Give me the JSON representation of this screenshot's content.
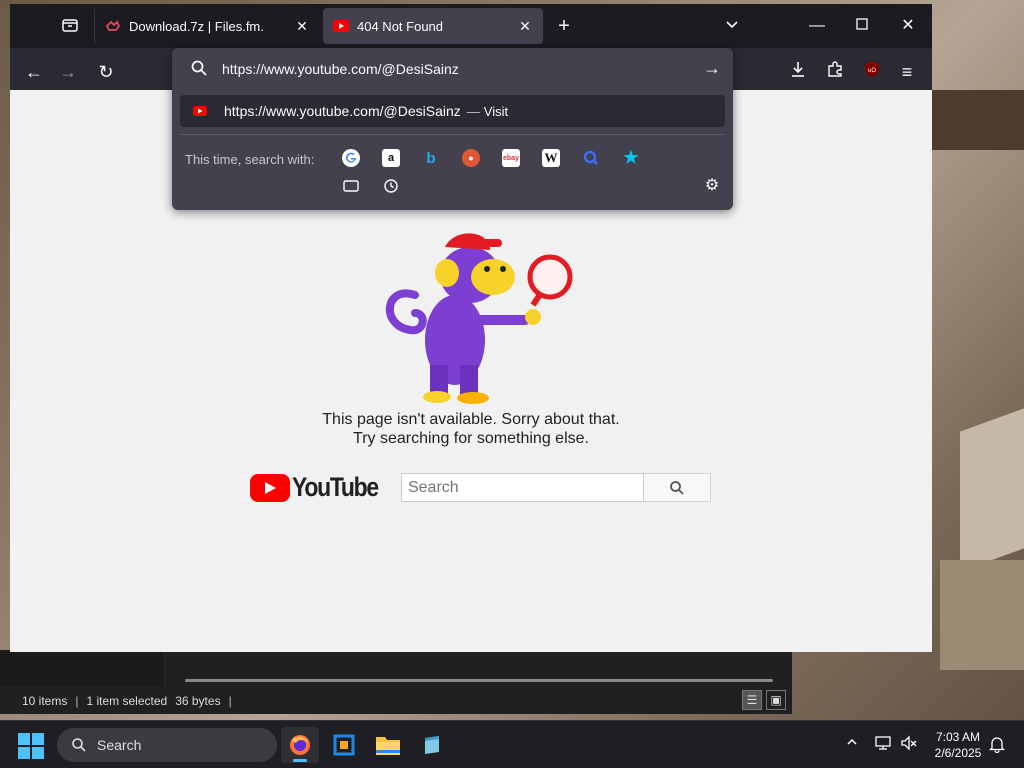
{
  "browser": {
    "tabs": [
      {
        "title": "Download.7z | Files.fm."
      },
      {
        "title": "404 Not Found"
      }
    ],
    "urlbar": {
      "value": "https://www.youtube.com/@DesiSainz",
      "suggestion_url": "https://www.youtube.com/@DesiSainz",
      "suggestion_separator": "—",
      "suggestion_action": "Visit",
      "search_with_label": "This time, search with:",
      "engines": [
        "google-icon",
        "amazon-icon",
        "bing-icon",
        "duckduckgo-icon",
        "ebay-icon",
        "wikipedia-icon",
        "search-icon",
        "bookmarks-star-icon",
        "tabs-icon",
        "history-icon"
      ]
    }
  },
  "page": {
    "message_line1": "This page isn't available. Sorry about that.",
    "message_line2": "Try searching for something else.",
    "logo_text": "YouTube",
    "search_placeholder": "Search"
  },
  "explorer": {
    "item_count": "10 items",
    "selection": "1 item selected",
    "size": "36 bytes"
  },
  "taskbar": {
    "search_label": "Search",
    "time": "7:03 AM",
    "date": "2/6/2025"
  },
  "colors": {
    "accent": "#4cc2ff",
    "youtube_red": "#ff0000",
    "monkey_purple": "#7c3fd1",
    "monkey_yellow": "#f7d22a"
  }
}
